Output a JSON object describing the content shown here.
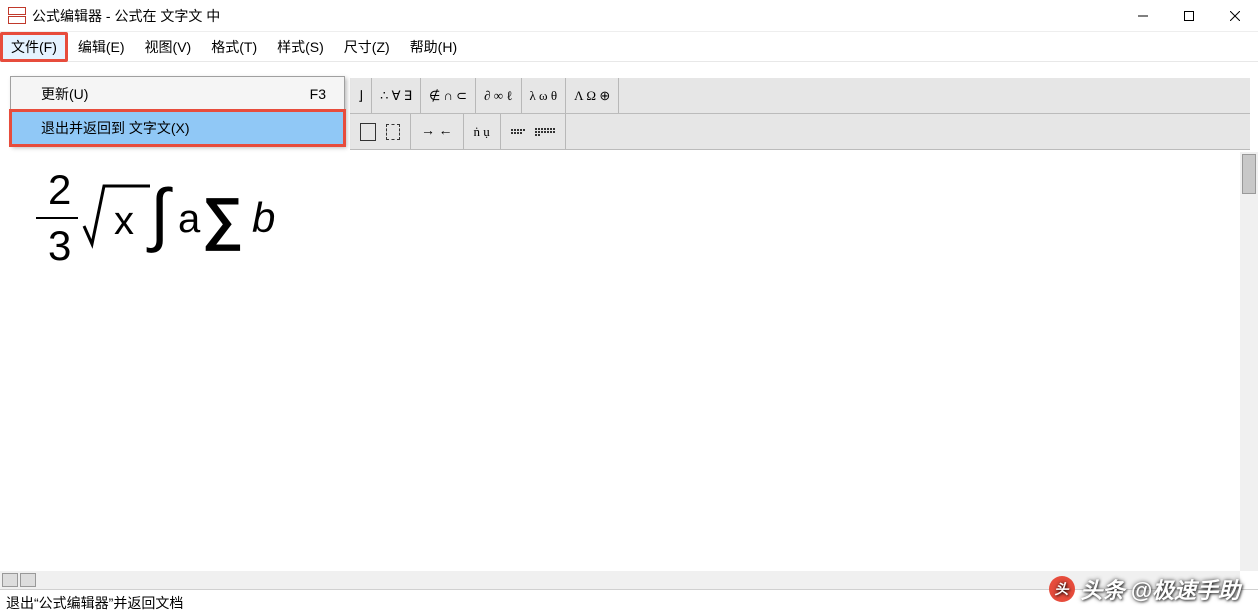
{
  "window": {
    "title": "公式编辑器 - 公式在 文字文 中"
  },
  "menubar": {
    "items": [
      {
        "label": "文件(F)"
      },
      {
        "label": "编辑(E)"
      },
      {
        "label": "视图(V)"
      },
      {
        "label": "格式(T)"
      },
      {
        "label": "样式(S)"
      },
      {
        "label": "尺寸(Z)"
      },
      {
        "label": "帮助(H)"
      }
    ]
  },
  "dropdown": {
    "items": [
      {
        "label": "更新(U)",
        "shortcut": "F3"
      },
      {
        "label": "退出并返回到 文字文(X)",
        "shortcut": ""
      }
    ]
  },
  "toolbar": {
    "row1": [
      "∴ ∀ ∃",
      "∉ ∩ ⊂",
      "∂ ∞ ℓ",
      "λ ω θ",
      "Λ Ω ⊕"
    ],
    "row2_arrows": "→  ←",
    "row2_struct": "ṅ  ụ"
  },
  "formula": {
    "display": "(2/3) √x ∫ a Σ b",
    "numerator": "2",
    "denominator": "3",
    "radicand": "x",
    "integral_var": "a",
    "sum_var": "b"
  },
  "statusbar": {
    "text": "退出“公式编辑器”并返回文档"
  },
  "watermark": {
    "brand": "头条",
    "handle": "@极速手助"
  }
}
